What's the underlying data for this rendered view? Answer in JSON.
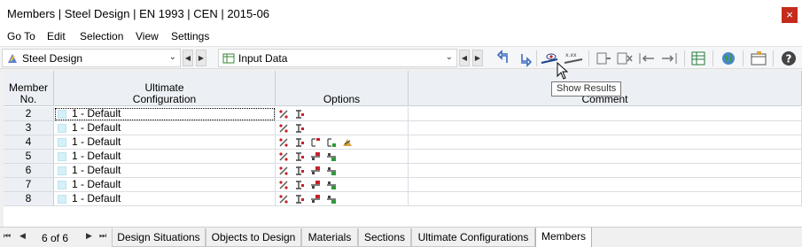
{
  "window": {
    "title": "Members | Steel Design | EN 1993 | CEN | 2015-06",
    "close": "×"
  },
  "menu": {
    "items": [
      "Go To",
      "Edit",
      "Selection",
      "View",
      "Settings"
    ]
  },
  "toolbar": {
    "module_combo": "Steel Design",
    "table_combo": "Input Data",
    "tooltip": "Show Results",
    "result_icon_text": "x.xx"
  },
  "grid": {
    "headers": {
      "member_l1": "Member",
      "member_l2": "No.",
      "ucfg_l1": "Ultimate",
      "ucfg_l2": "Configuration",
      "options": "Options",
      "comment": "Comment"
    },
    "rows": [
      {
        "member": "2",
        "config": "1 - Default",
        "options": [
          "member-icon",
          "section-icon"
        ]
      },
      {
        "member": "3",
        "config": "1 - Default",
        "options": [
          "member-icon",
          "section-icon"
        ]
      },
      {
        "member": "4",
        "config": "1 - Default",
        "options": [
          "member-icon",
          "section-icon",
          "support-icon",
          "hinge-icon",
          "torsion-icon"
        ]
      },
      {
        "member": "5",
        "config": "1 - Default",
        "options": [
          "member-icon",
          "section-icon",
          "lateral-red-icon",
          "lateral-green-icon"
        ]
      },
      {
        "member": "6",
        "config": "1 - Default",
        "options": [
          "member-icon",
          "section-icon",
          "lateral-red-icon",
          "lateral-green-icon"
        ]
      },
      {
        "member": "7",
        "config": "1 - Default",
        "options": [
          "member-icon",
          "section-icon",
          "lateral-red-icon",
          "lateral-green-icon"
        ]
      },
      {
        "member": "8",
        "config": "1 - Default",
        "options": [
          "member-icon",
          "section-icon",
          "lateral-red-icon",
          "lateral-green-icon"
        ]
      }
    ]
  },
  "tabs": {
    "pager": "6 of 6",
    "items": [
      "Design Situations",
      "Objects to Design",
      "Materials",
      "Sections",
      "Ultimate Configurations",
      "Members"
    ],
    "active": "Members"
  },
  "colors": {
    "close": "#c42b1c",
    "header_bg": "#ecf0f4",
    "config_swatch": "#d5f0f8"
  }
}
